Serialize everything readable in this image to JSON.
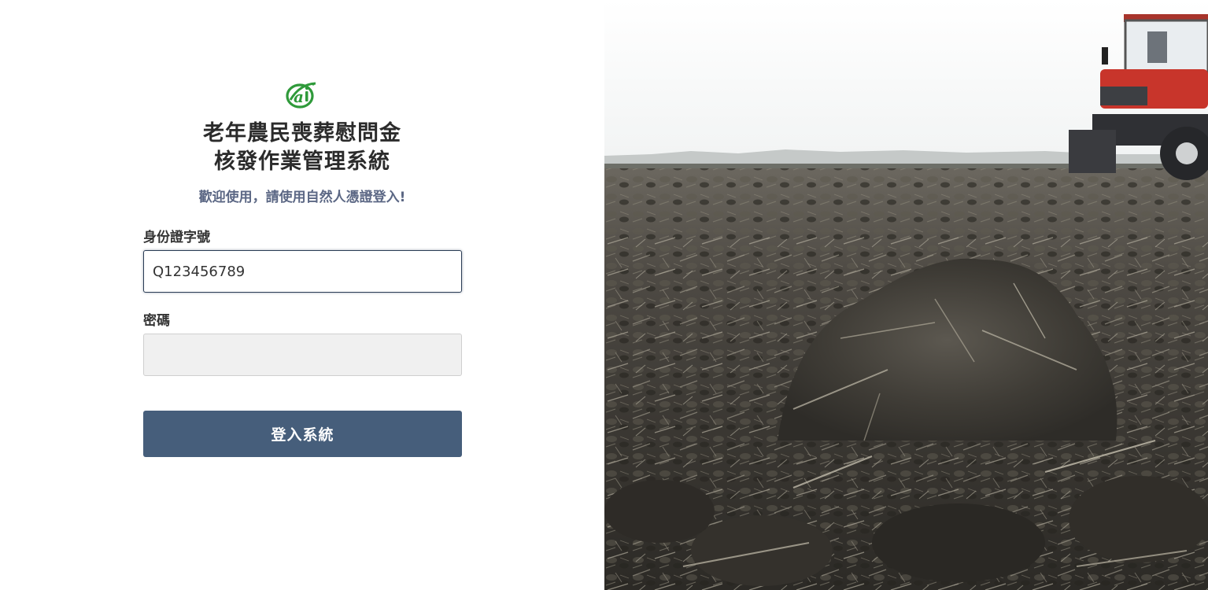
{
  "header": {
    "title_line1": "老年農民喪葬慰問金",
    "title_line2": "核發作業管理系統",
    "welcome": "歡迎使用，請使用自然人憑證登入!"
  },
  "form": {
    "id_label": "身份證字號",
    "id_value": "Q123456789",
    "password_label": "密碼",
    "password_value": "",
    "submit_label": "登入系統"
  },
  "colors": {
    "button": "#465e7b",
    "subtitle": "#5b6784",
    "logo_green": "#2f9a3a",
    "tractor_red": "#c8352b"
  },
  "icons": {
    "logo": "agency-logo-icon"
  },
  "photo": {
    "subject": "plowed-soil-with-tractor"
  }
}
